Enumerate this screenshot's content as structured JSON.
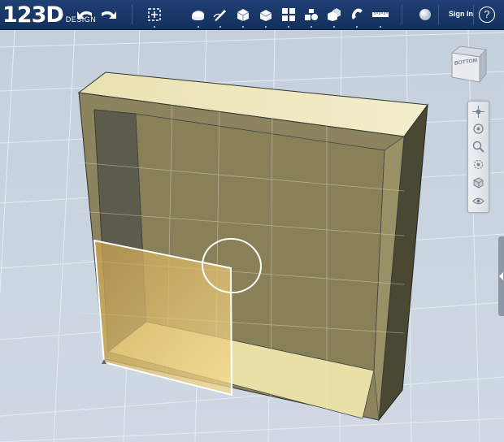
{
  "app": {
    "logo_main": "123D",
    "logo_sub": "DESIGN"
  },
  "toolbar": {
    "undo_icon": "undo-arrow-icon",
    "redo_icon": "redo-arrow-icon",
    "tools": [
      {
        "name": "transform",
        "icon": "transform-icon"
      },
      {
        "name": "primitives",
        "icon": "primitives-icon"
      },
      {
        "name": "sketch",
        "icon": "sketch-icon"
      },
      {
        "name": "construct",
        "icon": "construct-icon"
      },
      {
        "name": "modify",
        "icon": "modify-icon"
      },
      {
        "name": "pattern",
        "icon": "pattern-icon"
      },
      {
        "name": "grouping",
        "icon": "grouping-icon"
      },
      {
        "name": "combine",
        "icon": "combine-icon"
      },
      {
        "name": "snap",
        "icon": "snap-icon"
      },
      {
        "name": "measure",
        "icon": "measure-icon"
      },
      {
        "name": "material",
        "icon": "material-icon"
      }
    ],
    "signin_label": "Sign In",
    "help_label": "?"
  },
  "viewcube": {
    "face_label": "BOTTOM"
  },
  "navbar": {
    "buttons": [
      "pan-icon",
      "orbit-icon",
      "zoom-icon",
      "fit-icon",
      "view-icon",
      "visibility-icon"
    ]
  },
  "colors": {
    "toolbar_bg": "#1a3868",
    "canvas_bg": "#c9d4df",
    "box_face": "#86805a",
    "selection_fill": "#f2d78a",
    "selection_outline": "#ffffff"
  }
}
